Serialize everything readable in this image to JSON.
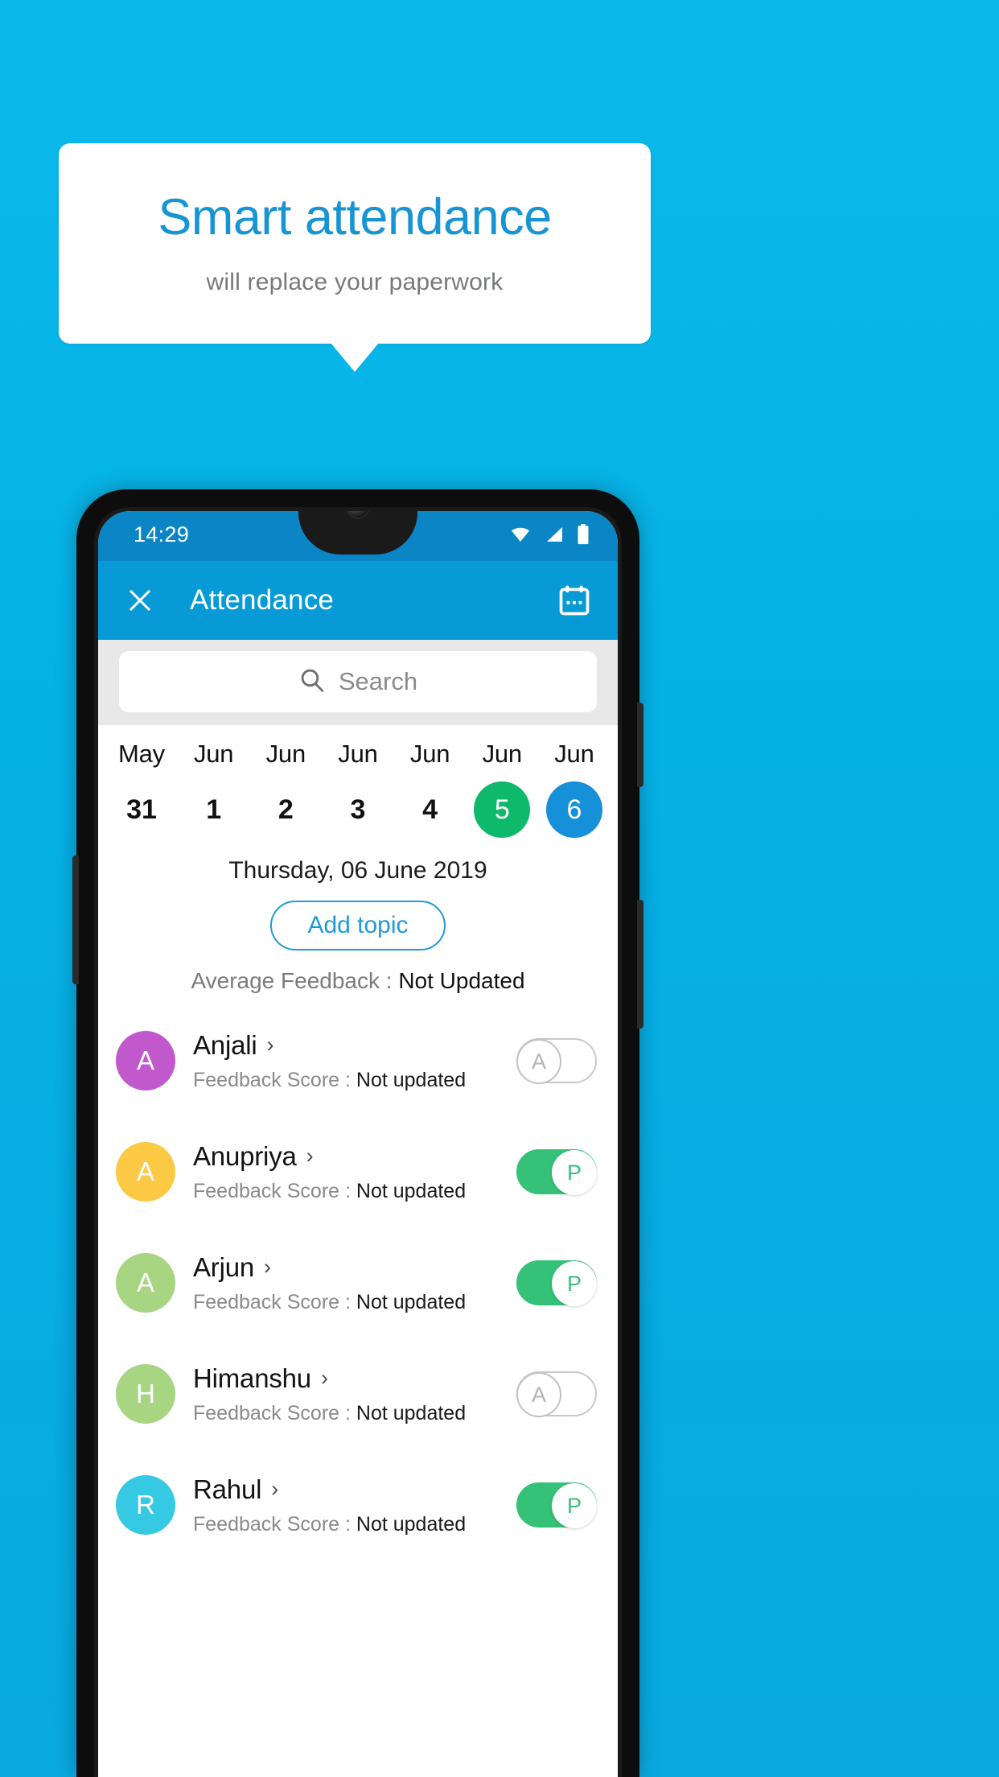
{
  "promo": {
    "title": "Smart attendance",
    "subtitle": "will replace your paperwork",
    "title_color": "#1794d4",
    "subtitle_color": "#77797b",
    "background_color": "#0ab9ea"
  },
  "status_bar": {
    "time": "14:29",
    "icons": [
      "wifi-icon",
      "signal-icon",
      "battery-icon"
    ],
    "background_color": "#0a86c6"
  },
  "app_bar": {
    "close_label": "close-icon",
    "title": "Attendance",
    "calendar_label": "calendar-icon",
    "background_color": "#079ad6"
  },
  "search": {
    "placeholder": "Search",
    "icon": "search-icon"
  },
  "date_strip": [
    {
      "month": "May",
      "day": "31",
      "state": "normal"
    },
    {
      "month": "Jun",
      "day": "1",
      "state": "normal"
    },
    {
      "month": "Jun",
      "day": "2",
      "state": "normal"
    },
    {
      "month": "Jun",
      "day": "3",
      "state": "normal"
    },
    {
      "month": "Jun",
      "day": "4",
      "state": "normal"
    },
    {
      "month": "Jun",
      "day": "5",
      "state": "today"
    },
    {
      "month": "Jun",
      "day": "6",
      "state": "selected"
    }
  ],
  "date_colors": {
    "today": "#0fb96b",
    "selected": "#1690d8"
  },
  "day_header": "Thursday, 06 June 2019",
  "add_topic_label": "Add topic",
  "average_feedback": {
    "label": "Average Feedback : ",
    "value": "Not Updated"
  },
  "score_label": "Feedback Score : ",
  "students": [
    {
      "name": "Anjali",
      "initial": "A",
      "avatar_color": "#c159cd",
      "score": "Not updated",
      "attendance": "A",
      "present": false
    },
    {
      "name": "Anupriya",
      "initial": "A",
      "avatar_color": "#fcc945",
      "score": "Not updated",
      "attendance": "P",
      "present": true
    },
    {
      "name": "Arjun",
      "initial": "A",
      "avatar_color": "#a7d582",
      "score": "Not updated",
      "attendance": "P",
      "present": true
    },
    {
      "name": "Himanshu",
      "initial": "H",
      "avatar_color": "#a7d582",
      "score": "Not updated",
      "attendance": "A",
      "present": false
    },
    {
      "name": "Rahul",
      "initial": "R",
      "avatar_color": "#35c9e4",
      "score": "Not updated",
      "attendance": "P",
      "present": true
    }
  ],
  "toggle_colors": {
    "present": "#35c178",
    "absent_border": "#c9c9c9"
  }
}
